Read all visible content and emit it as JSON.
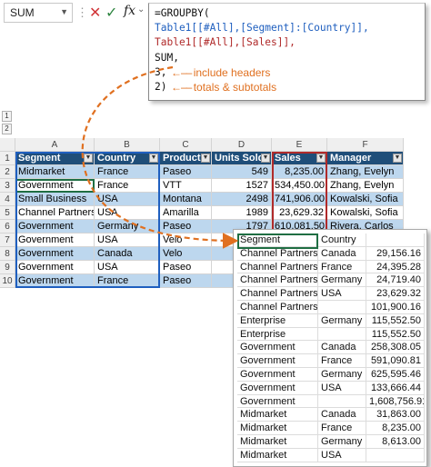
{
  "formula_bar": {
    "name_box": "SUM",
    "fx_label": "fx",
    "lines": [
      {
        "segments": [
          {
            "text": "=GROUPBY(",
            "color": "black"
          }
        ]
      },
      {
        "segments": [
          {
            "text": "Table1[[#All],[Segment]:[Country]],",
            "color": "blue"
          }
        ]
      },
      {
        "segments": [
          {
            "text": "Table1[[#All],[Sales]],",
            "color": "red"
          }
        ]
      },
      {
        "segments": [
          {
            "text": "SUM,",
            "color": "black"
          }
        ]
      },
      {
        "segments": [
          {
            "text": "3,",
            "color": "black"
          }
        ],
        "annotation": "include headers"
      },
      {
        "segments": [
          {
            "text": "2)",
            "color": "black"
          }
        ],
        "annotation": "totals & subtotals"
      }
    ]
  },
  "outline_levels": [
    "1",
    "2"
  ],
  "sheet": {
    "column_letters": [
      "A",
      "B",
      "C",
      "D",
      "E",
      "F"
    ],
    "headers": [
      "Segment",
      "Country",
      "Product",
      "Units Sold",
      "Sales",
      "Manager"
    ],
    "rows": [
      {
        "num": "2",
        "cells": [
          "Midmarket",
          "France",
          "Paseo",
          "549",
          "8,235.00",
          "Zhang, Evelyn"
        ]
      },
      {
        "num": "3",
        "cells": [
          "Government",
          "France",
          "VTT",
          "1527",
          "534,450.00",
          "Zhang, Evelyn"
        ]
      },
      {
        "num": "4",
        "cells": [
          "Small Business",
          "USA",
          "Montana",
          "2498",
          "741,906.00",
          "Kowalski, Sofia"
        ]
      },
      {
        "num": "5",
        "cells": [
          "Channel Partners",
          "USA",
          "Amarilla",
          "1989",
          "23,629.32",
          "Kowalski, Sofia"
        ]
      },
      {
        "num": "6",
        "cells": [
          "Government",
          "Germany",
          "Paseo",
          "1797",
          "610,081.50",
          "Rivera, Carlos"
        ]
      },
      {
        "num": "7",
        "cells": [
          "Government",
          "USA",
          "Velo",
          "",
          "",
          ""
        ]
      },
      {
        "num": "8",
        "cells": [
          "Government",
          "Canada",
          "Velo",
          "",
          "",
          ""
        ]
      },
      {
        "num": "9",
        "cells": [
          "Government",
          "USA",
          "Paseo",
          "",
          "",
          ""
        ]
      },
      {
        "num": "10",
        "cells": [
          "Government",
          "France",
          "Paseo",
          "",
          "",
          ""
        ]
      }
    ]
  },
  "result": {
    "header": [
      "Segment",
      "Country",
      ""
    ],
    "rows": [
      [
        "Channel Partners",
        "Canada",
        "29,156.16"
      ],
      [
        "Channel Partners",
        "France",
        "24,395.28"
      ],
      [
        "Channel Partners",
        "Germany",
        "24,719.40"
      ],
      [
        "Channel Partners",
        "USA",
        "23,629.32"
      ],
      [
        "Channel Partners",
        "",
        "101,900.16"
      ],
      [
        "Enterprise",
        "Germany",
        "115,552.50"
      ],
      [
        "Enterprise",
        "",
        "115,552.50"
      ],
      [
        "Government",
        "Canada",
        "258,308.05"
      ],
      [
        "Government",
        "France",
        "591,090.81"
      ],
      [
        "Government",
        "Germany",
        "625,595.46"
      ],
      [
        "Government",
        "USA",
        "133,666.44"
      ],
      [
        "Government",
        "",
        "1,608,756.91"
      ],
      [
        "Midmarket",
        "Canada",
        "31,863.00"
      ],
      [
        "Midmarket",
        "France",
        "8,235.00"
      ],
      [
        "Midmarket",
        "Germany",
        "8,613.00"
      ],
      [
        "Midmarket",
        "USA",
        ""
      ]
    ]
  },
  "colors": {
    "header_fill": "#1f4e79",
    "band_fill": "#bdd7ee",
    "annotation": "#e07020",
    "blue_ref": "#1f5fbf",
    "red_ref": "#b02a2a"
  }
}
